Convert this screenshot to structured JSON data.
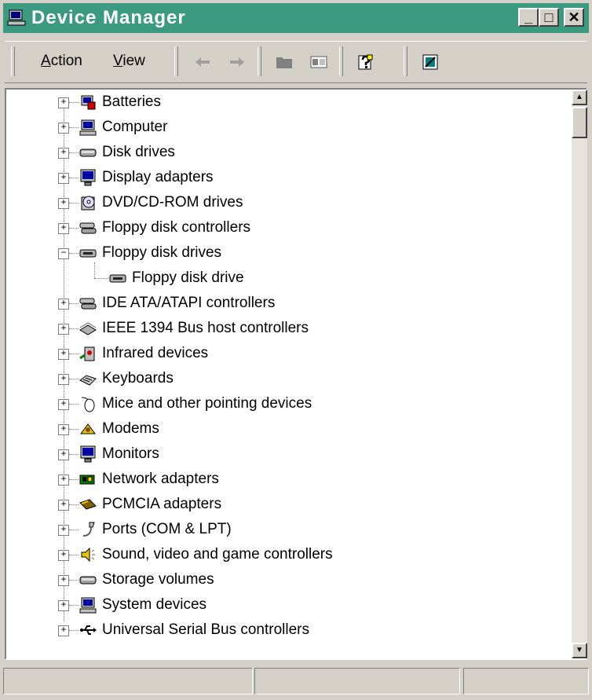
{
  "window": {
    "title": "Device Manager",
    "buttons": {
      "minimize": "_",
      "maximize": "□",
      "close": "✕"
    }
  },
  "toolbar": {
    "menu": [
      {
        "label": "Action",
        "accel": "A"
      },
      {
        "label": "View",
        "accel": "V"
      }
    ],
    "buttons": [
      "back-icon",
      "forward-icon",
      "folder-icon",
      "properties-icon",
      "help-icon",
      "scan-hardware-icon"
    ]
  },
  "tree": {
    "items": [
      {
        "label": "Batteries",
        "icon": "battery-icon",
        "expanded": false
      },
      {
        "label": "Computer",
        "icon": "computer-icon",
        "expanded": false
      },
      {
        "label": "Disk drives",
        "icon": "disk-drive-icon",
        "expanded": false
      },
      {
        "label": "Display adapters",
        "icon": "display-adapter-icon",
        "expanded": false
      },
      {
        "label": "DVD/CD-ROM drives",
        "icon": "cdrom-icon",
        "expanded": false
      },
      {
        "label": "Floppy disk controllers",
        "icon": "floppy-controller-icon",
        "expanded": false
      },
      {
        "label": "Floppy disk drives",
        "icon": "floppy-drive-icon",
        "expanded": true,
        "children": [
          {
            "label": "Floppy disk drive",
            "icon": "floppy-drive-icon"
          }
        ]
      },
      {
        "label": "IDE ATA/ATAPI controllers",
        "icon": "ide-controller-icon",
        "expanded": false
      },
      {
        "label": "IEEE 1394 Bus host controllers",
        "icon": "ieee1394-icon",
        "expanded": false
      },
      {
        "label": "Infrared devices",
        "icon": "infrared-icon",
        "expanded": false
      },
      {
        "label": "Keyboards",
        "icon": "keyboard-icon",
        "expanded": false
      },
      {
        "label": "Mice and other pointing devices",
        "icon": "mouse-icon",
        "expanded": false
      },
      {
        "label": "Modems",
        "icon": "modem-icon",
        "expanded": false
      },
      {
        "label": "Monitors",
        "icon": "monitor-icon",
        "expanded": false
      },
      {
        "label": "Network adapters",
        "icon": "network-adapter-icon",
        "expanded": false
      },
      {
        "label": "PCMCIA adapters",
        "icon": "pcmcia-icon",
        "expanded": false
      },
      {
        "label": "Ports (COM & LPT)",
        "icon": "port-icon",
        "expanded": false
      },
      {
        "label": "Sound, video and game controllers",
        "icon": "sound-icon",
        "expanded": false
      },
      {
        "label": "Storage volumes",
        "icon": "storage-volume-icon",
        "expanded": false
      },
      {
        "label": "System devices",
        "icon": "system-device-icon",
        "expanded": false
      },
      {
        "label": "Universal Serial Bus controllers",
        "icon": "usb-icon",
        "expanded": false
      }
    ]
  },
  "statusbar": {
    "panels": [
      "",
      "",
      ""
    ]
  },
  "colors": {
    "titlebar": "#3c9a81",
    "face": "#d4d0c8",
    "pane": "#ffffff"
  }
}
